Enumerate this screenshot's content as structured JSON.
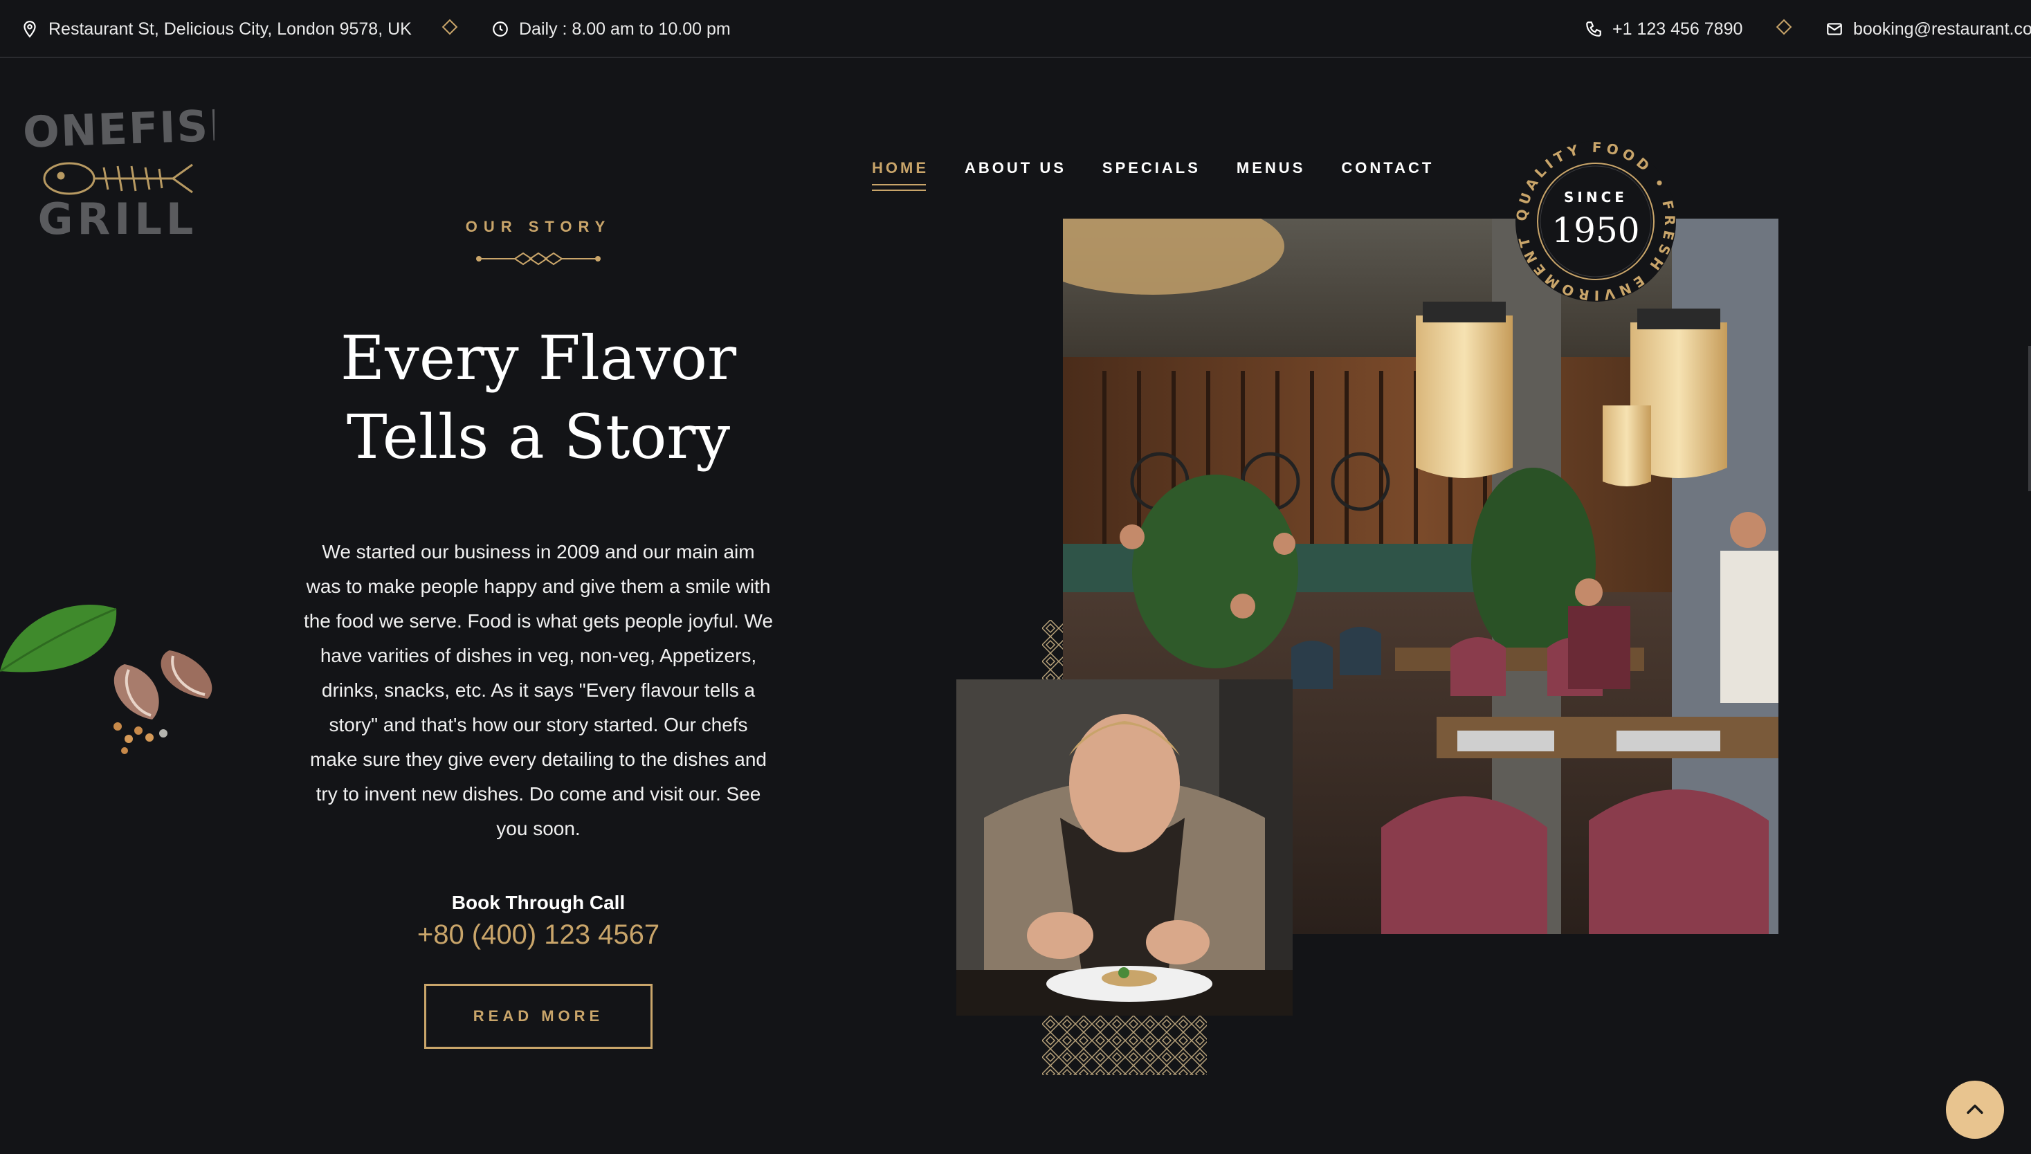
{
  "topbar": {
    "address": "Restaurant St, Delicious City, London 9578, UK",
    "hours": "Daily : 8.00 am to 10.00 pm",
    "phone": "+1 123 456 7890",
    "email": "booking@restaurant.co"
  },
  "logo": {
    "line1": "BONEFISH",
    "line2": "GRILL"
  },
  "nav": {
    "items": [
      {
        "label": "HOME"
      },
      {
        "label": "ABOUT US"
      },
      {
        "label": "SPECIALS"
      },
      {
        "label": "MENUS"
      },
      {
        "label": "CONTACT"
      }
    ],
    "active": "HOME"
  },
  "story": {
    "eyebrow": "OUR STORY",
    "headline_line1": "Every Flavor",
    "headline_line2": "Tells a Story",
    "body": "We started our business in 2009 and our main aim was to make people happy and give them a smile with the food we serve. Food is what gets people joyful. We have varities of dishes in veg, non-veg, Appetizers, drinks, snacks, etc. As it says \"Every flavour tells a story\" and that's how our story started. Our chefs make sure they give every detailing to the dishes and try to invent new dishes. Do come and visit our. See you soon.",
    "book_label": "Book Through Call",
    "book_phone": "+80 (400) 123 4567",
    "read_more": "READ MORE"
  },
  "badge": {
    "since": "SINCE",
    "year": "1950",
    "ring_text": "QUALITY FOOD • FRESH ENVIROMENT •"
  },
  "icons": {
    "address": "location-pin-icon",
    "hours": "clock-icon",
    "phone": "phone-icon",
    "email": "mail-icon",
    "scroll": "chevron-up-icon"
  },
  "colors": {
    "accent": "#c9a56a",
    "background": "#131417",
    "scroll_button": "#e8c48f"
  }
}
